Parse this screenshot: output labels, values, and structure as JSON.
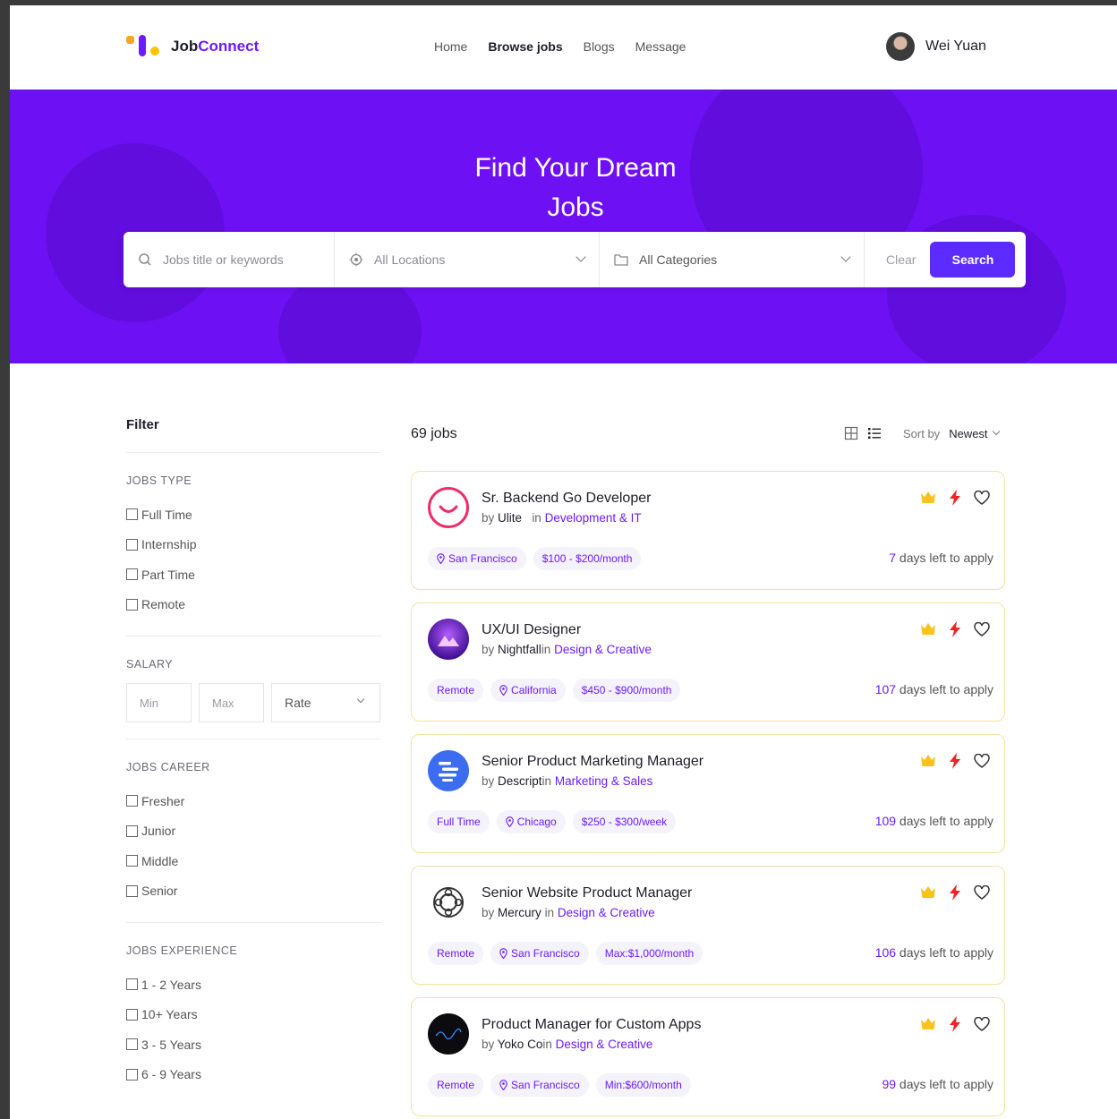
{
  "header": {
    "logo": {
      "part1": "Job",
      "part2": "Connect"
    },
    "nav": [
      "Home",
      "Browse jobs",
      "Blogs",
      "Message"
    ],
    "user": "Wei Yuan"
  },
  "hero": {
    "title_line1": "Find Your Dream",
    "title_line2": "Jobs",
    "search": {
      "keywords_placeholder": "Jobs title or keywords",
      "location": "All Locations",
      "category": "All Categories",
      "clear": "Clear",
      "search": "Search"
    }
  },
  "filter": {
    "title": "Filter",
    "jobs_type": {
      "title": "JOBS TYPE",
      "items": [
        "Full Time",
        "Internship",
        "Part Time",
        "Remote"
      ]
    },
    "salary": {
      "title": "SALARY",
      "min": "Min",
      "max": "Max",
      "rate": "Rate"
    },
    "jobs_career": {
      "title": "JOBS CAREER",
      "items": [
        "Fresher",
        "Junior",
        "Middle",
        "Senior"
      ]
    },
    "jobs_experience": {
      "title": "JOBS EXPERIENCE",
      "items": [
        "1 - 2 Years",
        "10+ Years",
        "3 - 5 Years",
        "6 - 9 Years"
      ]
    }
  },
  "results": {
    "count": "69 jobs",
    "sort_label": "Sort by",
    "sort_value": "Newest"
  },
  "jobs": [
    {
      "title": "Sr. Backend Go Developer",
      "by": "by",
      "company": "Ulite",
      "in": "in",
      "category": "Development & IT",
      "tags": [
        "San Francisco",
        "$100 - $200/month"
      ],
      "days": "7",
      "days_suffix": " days left to apply"
    },
    {
      "title": "UX/UI Designer",
      "by": "by",
      "company": "Nightfall",
      "in": "in",
      "category": "Design & Creative",
      "tags": [
        "Remote",
        "California",
        "$450 - $900/month"
      ],
      "days": "107",
      "days_suffix": " days left to apply"
    },
    {
      "title": "Senior Product Marketing Manager",
      "by": "by",
      "company": "Descript",
      "in": "in",
      "category": "Marketing & Sales",
      "tags": [
        "Full Time",
        "Chicago",
        "$250 - $300/week"
      ],
      "days": "109",
      "days_suffix": " days left to apply"
    },
    {
      "title": "Senior Website Product Manager",
      "by": "by",
      "company": "Mercury",
      "in": "in",
      "category": "Design & Creative",
      "tags": [
        "Remote",
        "San Francisco",
        "Max:$1,000/month"
      ],
      "days": "106",
      "days_suffix": " days left to apply"
    },
    {
      "title": "Product Manager for Custom Apps",
      "by": "by",
      "company": "Yoko Co",
      "in": "in",
      "category": "Design & Creative",
      "tags": [
        "Remote",
        "San Francisco",
        "Min:$600/month"
      ],
      "days": "99",
      "days_suffix": " days left to apply"
    }
  ]
}
